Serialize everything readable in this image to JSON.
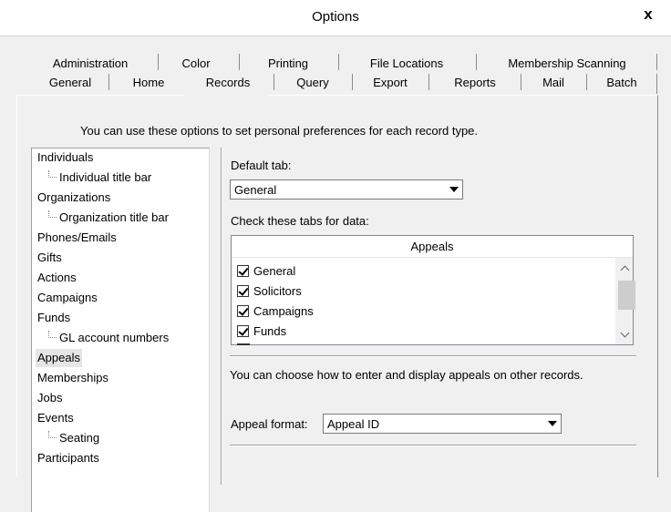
{
  "window": {
    "title": "Options",
    "close_glyph": "x"
  },
  "tabs_row1": [
    {
      "label": "Administration"
    },
    {
      "label": "Color"
    },
    {
      "label": "Printing"
    },
    {
      "label": "File Locations"
    },
    {
      "label": "Membership Scanning"
    }
  ],
  "tabs_row2": [
    {
      "label": "General"
    },
    {
      "label": "Home"
    },
    {
      "label": "Records",
      "active": true
    },
    {
      "label": "Query"
    },
    {
      "label": "Export"
    },
    {
      "label": "Reports"
    },
    {
      "label": "Mail"
    },
    {
      "label": "Batch"
    }
  ],
  "intro_text": "You can use these options to set personal preferences for each record type.",
  "tree": [
    {
      "label": "Individuals"
    },
    {
      "label": "Individual title bar",
      "child": true
    },
    {
      "label": "Organizations"
    },
    {
      "label": "Organization title bar",
      "child": true
    },
    {
      "label": "Phones/Emails"
    },
    {
      "label": "Gifts"
    },
    {
      "label": "Actions"
    },
    {
      "label": "Campaigns"
    },
    {
      "label": "Funds"
    },
    {
      "label": "GL account numbers",
      "child": true
    },
    {
      "label": "Appeals",
      "selected": true
    },
    {
      "label": "Memberships"
    },
    {
      "label": "Jobs"
    },
    {
      "label": "Events"
    },
    {
      "label": "Seating",
      "child": true
    },
    {
      "label": "Participants"
    }
  ],
  "settings": {
    "default_tab_label": "Default tab:",
    "default_tab_value": "General",
    "check_tabs_label": "Check these tabs for data:",
    "list_header": "Appeals",
    "list_items": [
      {
        "label": "General",
        "checked": true
      },
      {
        "label": "Solicitors",
        "checked": true
      },
      {
        "label": "Campaigns",
        "checked": true
      },
      {
        "label": "Funds",
        "checked": true
      }
    ],
    "choose_text": "You can choose how to enter and display appeals on other records.",
    "appeal_format_label": "Appeal format:",
    "appeal_format_value": "Appeal ID"
  }
}
